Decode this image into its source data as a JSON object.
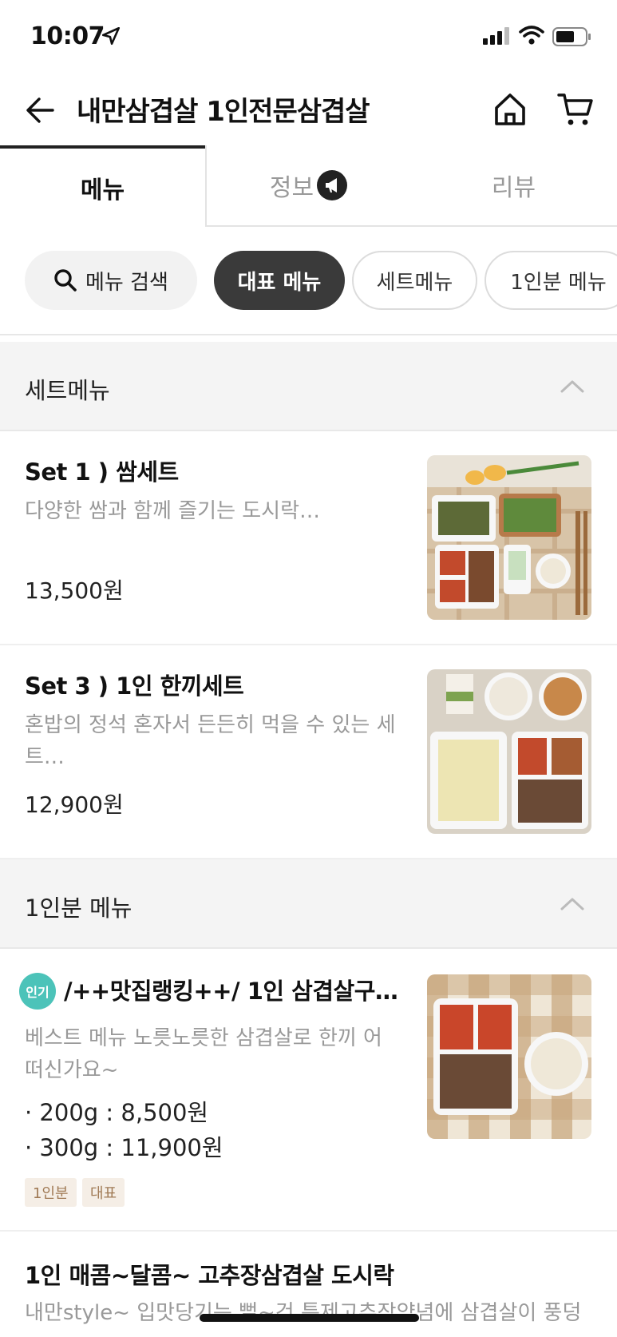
{
  "status": {
    "time": "10:07"
  },
  "nav": {
    "title": "내만삼겹살 1인전문삼겹살"
  },
  "tabs": [
    {
      "label": "메뉴",
      "active": true
    },
    {
      "label": "정보",
      "badge_icon": "megaphone-icon"
    },
    {
      "label": "리뷰"
    }
  ],
  "chips": {
    "search": "메뉴 검색",
    "items": [
      "대표 메뉴",
      "세트메뉴",
      "1인분 메뉴"
    ],
    "active_index": 0
  },
  "sections": [
    {
      "title": "세트메뉴",
      "items": [
        {
          "name": "Set 1 ) 쌈세트",
          "desc": "다양한 쌈과 함께 즐기는 도시락…",
          "price": "13,500원"
        },
        {
          "name": "Set 3 ) 1인 한끼세트",
          "desc": "혼밥의 정석 혼자서 든든히 먹을 수 있는 세트…",
          "price": "12,900원"
        }
      ]
    },
    {
      "title": "1인분 메뉴",
      "items": [
        {
          "badge": "인기",
          "name": "/++맛집랭킹++/ 1인 삼겹살구…",
          "desc": "베스트 메뉴 노릇노릇한 삼겹살로 한끼 어떠신가요~",
          "options": [
            "· 200g : 8,500원",
            "· 300g : 11,900원"
          ],
          "tags": [
            "1인분",
            "대표"
          ]
        },
        {
          "name": "1인 매콤~달콤~ 고추장삼겹살 도시락",
          "desc": "내만style~ 입맛당기는 뻘~건 특제고추장양념에 삼겹살이 풍덩"
        }
      ]
    }
  ],
  "colors": {
    "accent_dark": "#3a3a3a",
    "popular_badge": "#4cc3b9",
    "tag_bg": "#f5eee6",
    "tag_text": "#a07a55"
  }
}
